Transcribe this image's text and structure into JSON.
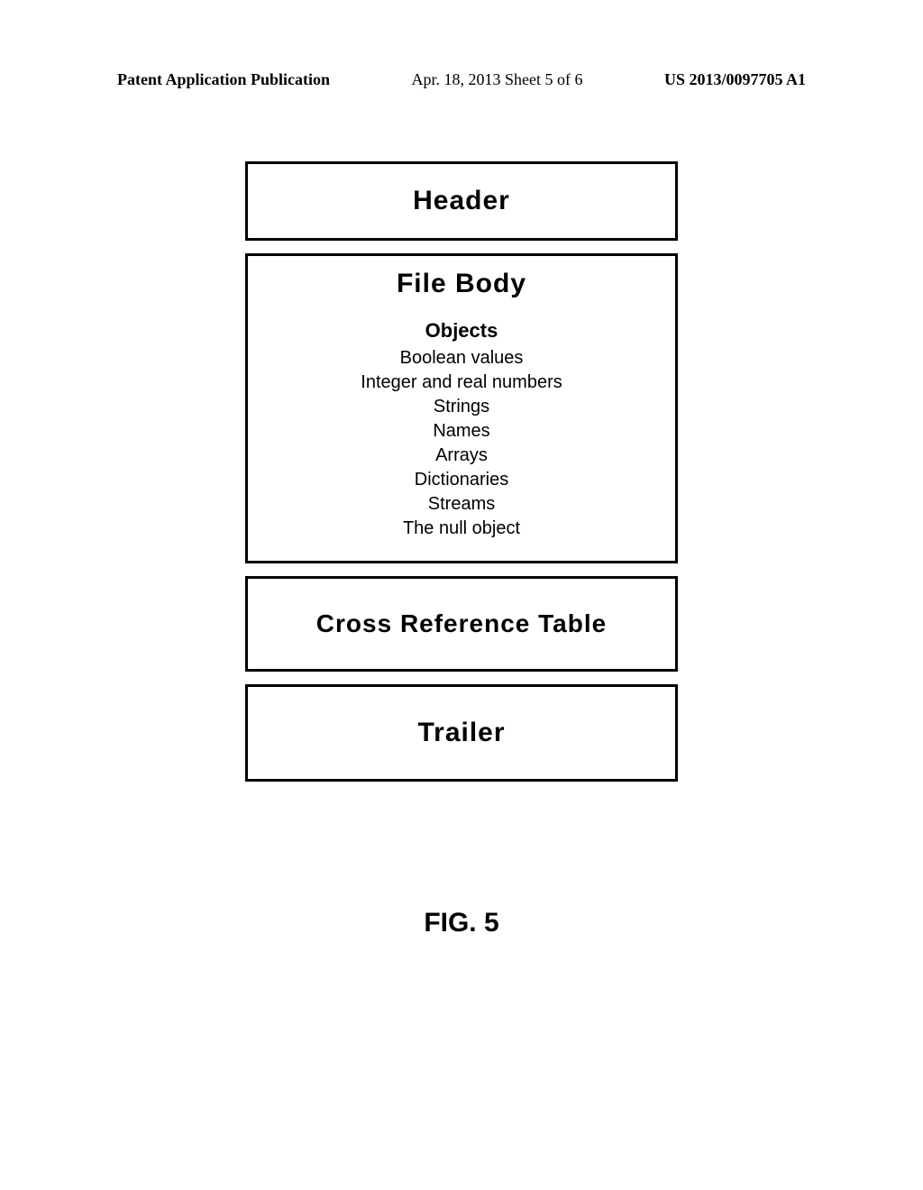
{
  "header": {
    "left": "Patent Application Publication",
    "center": "Apr. 18, 2013  Sheet 5 of 6",
    "right": "US 2013/0097705 A1"
  },
  "boxes": {
    "header_box": "Header",
    "file_body_title": "File Body",
    "objects_title": "Objects",
    "objects": [
      "Boolean values",
      "Integer and real numbers",
      "Strings",
      "Names",
      "Arrays",
      "Dictionaries",
      "Streams",
      "The null object"
    ],
    "xref_title": "Cross Reference Table",
    "trailer_title": "Trailer"
  },
  "figure_caption": "FIG. 5"
}
